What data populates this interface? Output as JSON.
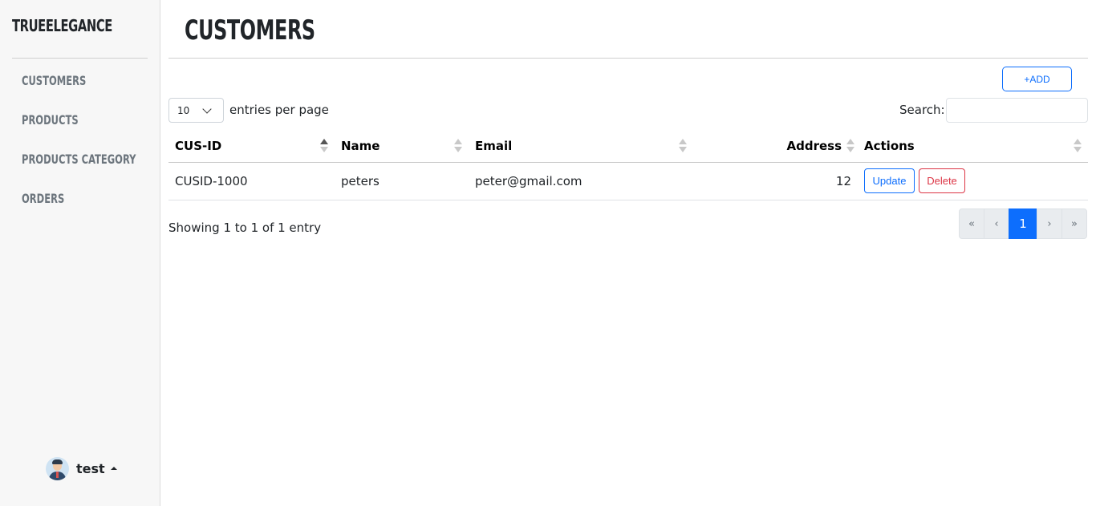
{
  "sidebar": {
    "brand": "TRUEELEGANCE",
    "items": [
      {
        "label": "CUSTOMERS"
      },
      {
        "label": "PRODUCTS"
      },
      {
        "label": "PRODUCTS CATEGORY"
      },
      {
        "label": "ORDERS"
      }
    ],
    "user": {
      "name": "test",
      "icon": "user-avatar-icon"
    }
  },
  "header": {
    "title": "CUSTOMERS"
  },
  "toolbar": {
    "add_label": "+ADD"
  },
  "table_controls": {
    "page_length_value": "10",
    "page_length_label": "entries per page",
    "search_label": "Search:",
    "search_value": ""
  },
  "table": {
    "columns": [
      {
        "label": "CUS-ID",
        "sort": "ascending"
      },
      {
        "label": "Name",
        "sort": "none"
      },
      {
        "label": "Email",
        "sort": "none"
      },
      {
        "label": "Address",
        "sort": "none"
      },
      {
        "label": "Actions",
        "sort": "none"
      }
    ],
    "rows": [
      {
        "id": "CUSID-1000",
        "name": "peters",
        "email": "peter@gmail.com",
        "address": "12",
        "update_label": "Update",
        "delete_label": "Delete"
      }
    ]
  },
  "footer": {
    "info": "Showing 1 to 1 of 1 entry",
    "pagination": {
      "first": "«",
      "prev": "‹",
      "current": "1",
      "next": "›",
      "last": "»"
    }
  },
  "colors": {
    "primary": "#0d6efd",
    "danger": "#dc3545",
    "sidebar_bg": "#f7f7f7",
    "nav_text": "#6c757d"
  }
}
